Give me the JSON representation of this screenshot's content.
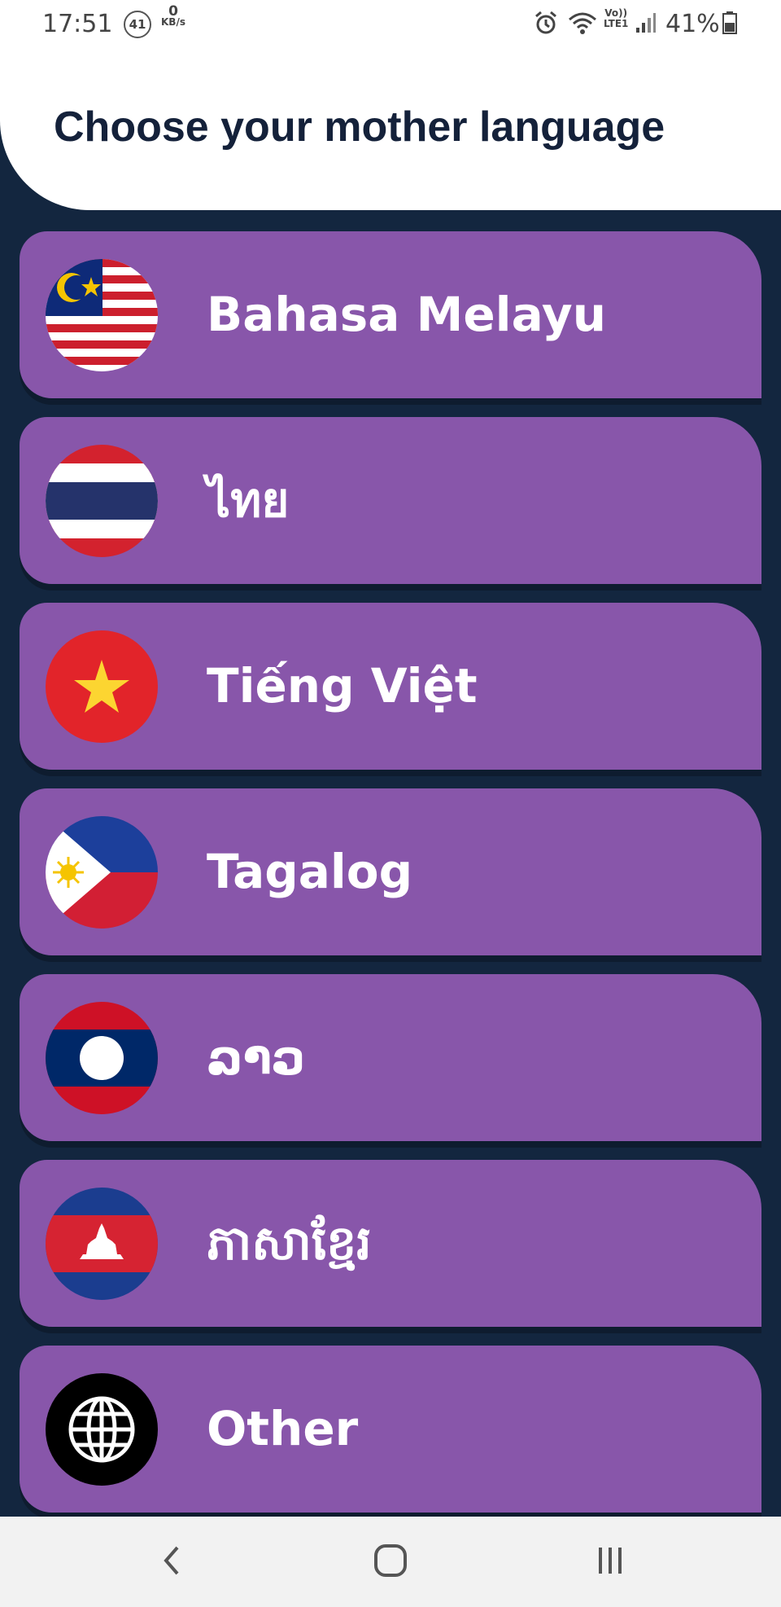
{
  "status_bar": {
    "time": "17:51",
    "notification_count": "41",
    "net_speed_value": "0",
    "net_speed_unit": "KB/s",
    "network_label_top": "Vo))",
    "network_label_bottom": "LTE1",
    "battery_percent": "41%",
    "icons": [
      "alarm-icon",
      "wifi-icon",
      "signal-icon",
      "battery-icon"
    ]
  },
  "header": {
    "title": "Choose your mother language"
  },
  "languages": [
    {
      "label": "Bahasa Melayu",
      "flag": "malaysia-flag-icon"
    },
    {
      "label": "ไทย",
      "flag": "thailand-flag-icon"
    },
    {
      "label": "Tiếng Việt",
      "flag": "vietnam-flag-icon"
    },
    {
      "label": "Tagalog",
      "flag": "philippines-flag-icon"
    },
    {
      "label": "ລາວ",
      "flag": "laos-flag-icon"
    },
    {
      "label": "ភាសាខ្មែរ",
      "flag": "cambodia-flag-icon"
    },
    {
      "label": "Other",
      "flag": "globe-icon"
    }
  ],
  "colors": {
    "background": "#13263f",
    "card": "#8856aa",
    "title": "#14213a",
    "header": "#ffffff",
    "nav_bar": "#f2f2f2"
  },
  "nav_bar": {
    "icons": [
      "back-icon",
      "home-icon",
      "recents-icon"
    ]
  }
}
